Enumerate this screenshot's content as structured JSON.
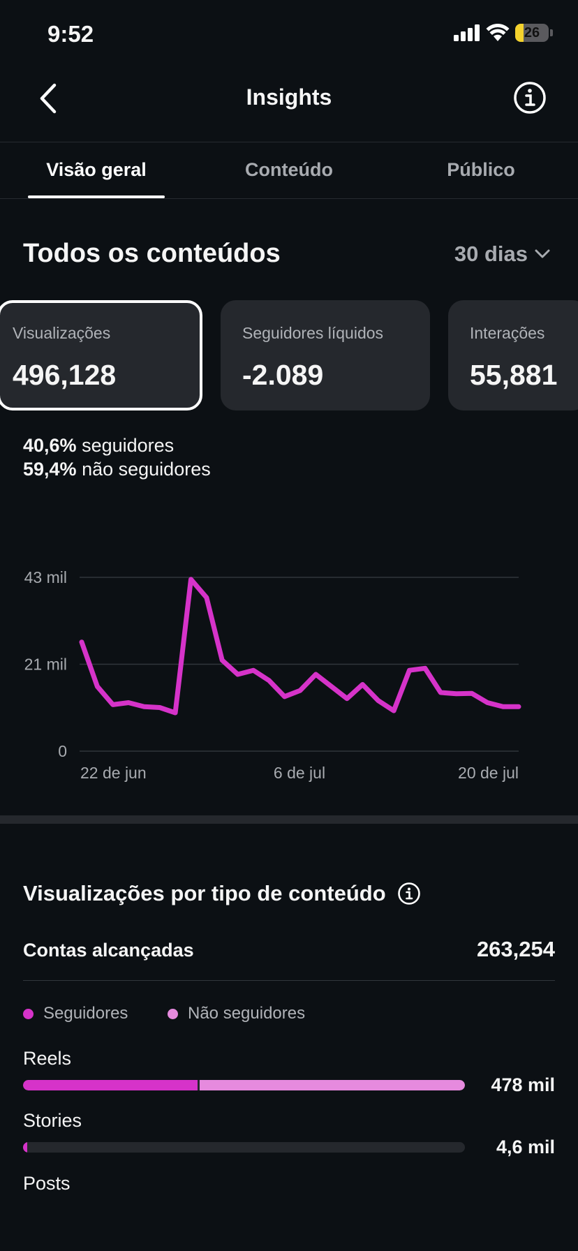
{
  "status_bar": {
    "time": "9:52",
    "battery": "26",
    "battery_level": 0.26
  },
  "header": {
    "title": "Insights"
  },
  "tabs": [
    {
      "label": "Visão geral",
      "active": true
    },
    {
      "label": "Conteúdo",
      "active": false
    },
    {
      "label": "Público",
      "active": false
    }
  ],
  "section": {
    "title": "Todos os conteúdos",
    "period": "30 dias"
  },
  "cards": [
    {
      "label": "Visualizações",
      "value": "496,128",
      "selected": true
    },
    {
      "label": "Seguidores líquidos",
      "value": "-2.089",
      "selected": false
    },
    {
      "label": "Interações",
      "value": "55,881",
      "selected": false
    }
  ],
  "split": {
    "followers_pct": "40,6%",
    "followers_text": "seguidores",
    "non_followers_pct": "59,4%",
    "non_followers_text": "não seguidores"
  },
  "chart_data": {
    "type": "line",
    "color": "#d633c9",
    "y_ticks": [
      "43 mil",
      "21 mil",
      "0"
    ],
    "ylim": [
      0,
      43
    ],
    "x_ticks": [
      "22 de jun",
      "6 de jul",
      "20 de jul"
    ],
    "grid": true,
    "series": [
      {
        "values": [
          27,
          16,
          11.5,
          12,
          11,
          10.8,
          9.5,
          42.5,
          38,
          22.5,
          19,
          20,
          17.5,
          13.5,
          15,
          19,
          16,
          13,
          16.5,
          12.5,
          10,
          20,
          20.5,
          14.5,
          14.2,
          14.3,
          12,
          11,
          11
        ]
      }
    ]
  },
  "content_types": {
    "title": "Visualizações por tipo de conteúdo",
    "reach_label": "Contas alcançadas",
    "reach_value": "263,254",
    "legend": [
      {
        "label": "Seguidores",
        "color": "#d633c9"
      },
      {
        "label": "Não seguidores",
        "color": "#e68ade"
      }
    ],
    "bars": [
      {
        "label": "Reels",
        "value": "478 mil",
        "followers_fraction": 0.395,
        "non_followers_fraction": 0.6
      },
      {
        "label": "Stories",
        "value": "4,6 mil",
        "followers_fraction": 0.006,
        "non_followers_fraction": 0
      },
      {
        "label": "Posts"
      }
    ]
  }
}
